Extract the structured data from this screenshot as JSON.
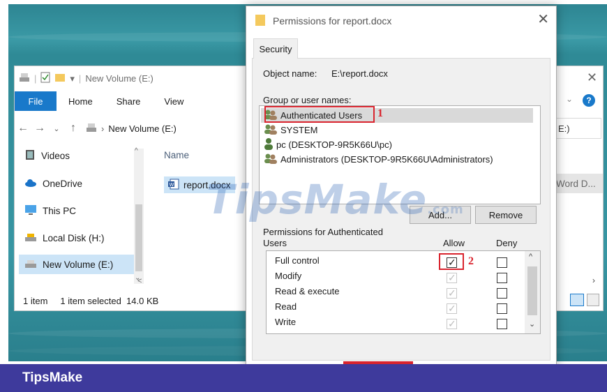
{
  "explorer": {
    "title": "New Volume (E:)",
    "tabs": [
      "File",
      "Home",
      "Share",
      "View"
    ],
    "address": "New Volume (E:)",
    "address_tail": "E:)",
    "nav_items": [
      {
        "label": "Videos",
        "icon": "video-icon"
      },
      {
        "label": "OneDrive",
        "icon": "cloud-icon"
      },
      {
        "label": "This PC",
        "icon": "computer-icon"
      },
      {
        "label": "Local Disk (H:)",
        "icon": "drive-icon"
      },
      {
        "label": "New Volume (E:)",
        "icon": "drive-icon",
        "selected": true
      }
    ],
    "column_name": "Name",
    "file_name": "report.docx",
    "file_type": "Word D...",
    "status_count": "1 item",
    "status_selected": "1 item selected  14.0 KB"
  },
  "dialog": {
    "title": "Permissions for report.docx",
    "tab": "Security",
    "object_label": "Object name:",
    "object_value": "E:\\report.docx",
    "group_label": "Group or user names:",
    "users": [
      {
        "name": "Authenticated Users",
        "icon": "users-group-icon",
        "selected": true
      },
      {
        "name": "SYSTEM",
        "icon": "users-group-icon"
      },
      {
        "name": "pc (DESKTOP-9R5K66U\\pc)",
        "icon": "user-icon"
      },
      {
        "name": "Administrators (DESKTOP-9R5K66U\\Administrators)",
        "icon": "users-group-icon"
      }
    ],
    "add_button": "Add...",
    "remove_button": "Remove",
    "perm_label_1": "Permissions for Authenticated",
    "perm_label_2": "Users",
    "allow_header": "Allow",
    "deny_header": "Deny",
    "permissions": [
      {
        "name": "Full control",
        "allow": true,
        "allow_enabled": true,
        "deny": false
      },
      {
        "name": "Modify",
        "allow": true,
        "allow_enabled": false,
        "deny": false
      },
      {
        "name": "Read & execute",
        "allow": true,
        "allow_enabled": false,
        "deny": false
      },
      {
        "name": "Read",
        "allow": true,
        "allow_enabled": false,
        "deny": false
      },
      {
        "name": "Write",
        "allow": true,
        "allow_enabled": false,
        "deny": false
      }
    ]
  },
  "annotations": {
    "marker_1": "1",
    "marker_2": "2",
    "color": "#d9232d"
  },
  "watermark": {
    "text": "TipsMake",
    "suffix": ".com"
  },
  "brand": {
    "name": "TipsMake",
    "bar_color": "#3e3a9c"
  }
}
